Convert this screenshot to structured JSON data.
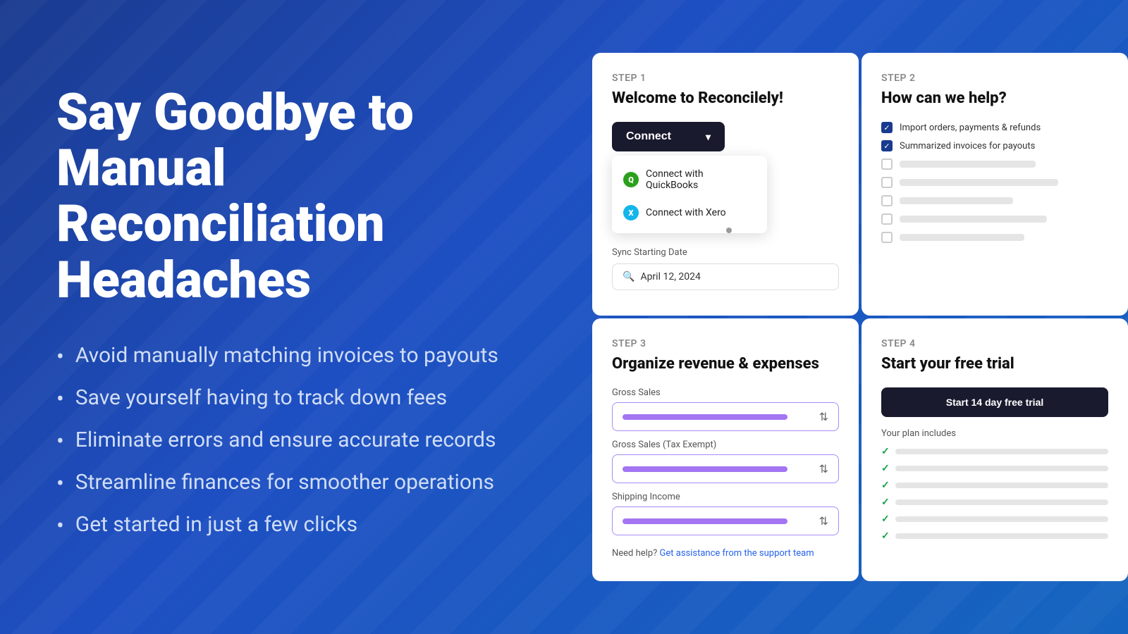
{
  "left": {
    "headline_line1": "Say Goodbye to Manual",
    "headline_line2": "Reconciliation Headaches",
    "bullets": [
      "Avoid manually matching invoices to payouts",
      "Save yourself having to track down fees",
      "Eliminate errors and ensure accurate records",
      "Streamline finances for smoother operations",
      "Get started in just a few clicks"
    ]
  },
  "card1": {
    "step": "STEP 1",
    "title": "Welcome to Reconcilely!",
    "connect_btn": "Connect",
    "dropdown_item1": "Connect with QuickBooks",
    "dropdown_item2": "Connect with Xero",
    "sync_label": "Sync Starting Date",
    "sync_date": "April 12, 2024"
  },
  "card2": {
    "step": "STEP 2",
    "title": "How can we help?",
    "checked_items": [
      "Import orders, payments & refunds",
      "Summarized invoices for payouts"
    ],
    "unchecked_lines": 5
  },
  "card3": {
    "step": "STEP 3",
    "title": "Organize revenue & expenses",
    "field1_label": "Gross Sales",
    "field2_label": "Gross Sales (Tax Exempt)",
    "field3_label": "Shipping Income",
    "help_prefix": "Need help?",
    "help_link": "Get assistance from the support team"
  },
  "card4": {
    "step": "STEP 4",
    "title": "Start your free trial",
    "trial_btn": "Start 14 day free trial",
    "plan_includes_label": "Your plan includes",
    "plan_items_count": 6
  }
}
